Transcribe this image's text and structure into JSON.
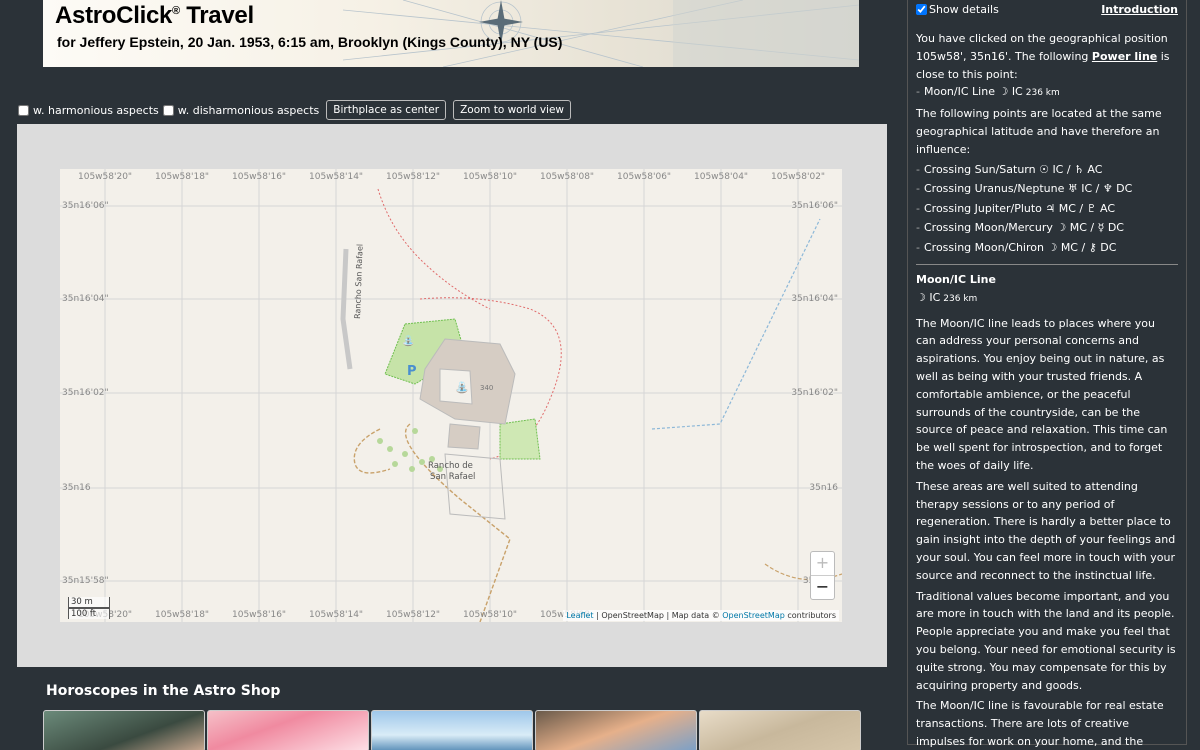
{
  "header": {
    "title": "AstroClick",
    "title_sup": "®",
    "title_suffix": " Travel",
    "subtitle": "for Jeffery Epstein, 20 Jan. 1953, 6:15 am, Brooklyn (Kings County), NY (US)"
  },
  "controls": {
    "harmonious_label": "w. harmonious aspects",
    "disharmonious_label": "w. disharmonious aspects",
    "birthplace_button": "Birthplace as center",
    "zoom_world_button": "Zoom to world view"
  },
  "map": {
    "top_ticks": [
      "105w58'20\"",
      "105w58'18\"",
      "105w58'16\"",
      "105w58'14\"",
      "105w58'12\"",
      "105w58'10\"",
      "105w58'08\"",
      "105w58'06\"",
      "105w58'04\"",
      "105w58'02\""
    ],
    "bottom_ticks": [
      "105w58'20\"",
      "105w58'18\"",
      "105w58'16\"",
      "105w58'14\"",
      "105w58'12\"",
      "105w58'10\"",
      "105w58'08"
    ],
    "left_ticks": [
      "35n16'06\"",
      "35n16'04\"",
      "35n16'02\"",
      "35n16",
      "35n15'58\""
    ],
    "right_ticks": [
      "35n16'06\"",
      "35n16'04\"",
      "35n16'02\"",
      "35n16",
      "35n"
    ],
    "road_label": "Rancho San Rafael",
    "place_label_1": "Rancho de",
    "place_label_2": "San Rafael",
    "house_number": "340",
    "parking": "P",
    "zoom_in": "+",
    "zoom_out": "−",
    "scale_m": "30 m",
    "scale_ft": "100 ft",
    "attribution": {
      "leaflet": "Leaflet",
      "sep1": " | OpenStreetMap | Map data © ",
      "osm": "OpenStreetMap",
      "contrib": " contributors"
    }
  },
  "shop": {
    "title": "Horoscopes in the Astro Shop"
  },
  "panel": {
    "show_details_label": "Show details",
    "introduction_link": "Introduction",
    "intro_text_1": "You have clicked on the geographical position 105w58', 35n16'. The following ",
    "power_line_link": "Power line",
    "intro_text_2": " is close to this point:",
    "close_line": "Moon/IC Line ☽ IC",
    "close_line_km": "236 km",
    "latitude_text": "The following points are located at the same geographical latitude and have therefore an influence:",
    "crossings": [
      "Crossing Sun/Saturn ☉ IC / ♄ AC",
      "Crossing Uranus/Neptune ♅ IC / ♆ DC",
      "Crossing Jupiter/Pluto ♃ MC / ♇ AC",
      "Crossing Moon/Mercury ☽ MC / ☿ DC",
      "Crossing Moon/Chiron ☽ MC / ⚷ DC"
    ],
    "section_title": "Moon/IC Line",
    "section_sub": "☽ IC",
    "section_km": "236 km",
    "paragraphs": [
      "The Moon/IC line leads to places where you can address your personal concerns and aspirations. You enjoy being out in nature, as well as being with your trusted friends. A comfortable ambience, or the peaceful surrounds of the countryside, can be the source of peace and relaxation. This time can be well spent for introspection, and to forget the woes of daily life.",
      "These areas are well suited to attending therapy sessions or to any period of regeneration. There is hardly a better place to gain insight into the depth of your feelings and your soul. You can feel more in touch with your source and reconnect to the instinctual life.",
      "Traditional values become important, and you are more in touch with the land and its people. People appreciate you and make you feel that you belong. Your need for emotional security is quite strong. You may compensate for this by acquiring property and goods.",
      "The Moon/IC line is favourable for real estate transactions. There are lots of creative impulses for work on your home, and the search for a new home is also easier here."
    ]
  }
}
